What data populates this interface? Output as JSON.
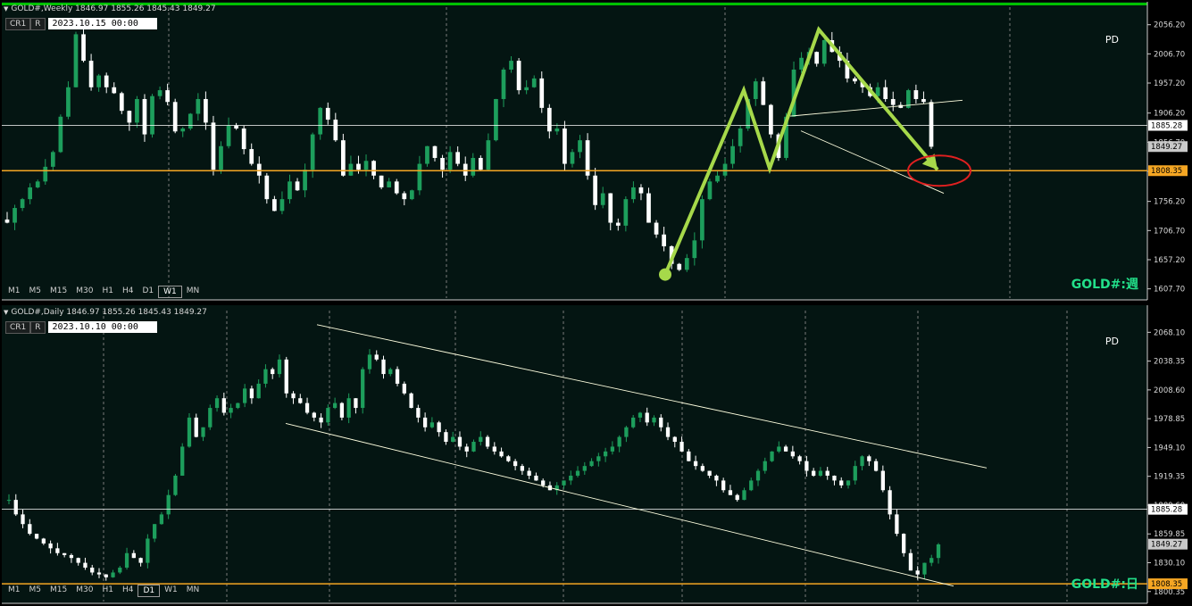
{
  "chart_data": [
    {
      "type": "candlestick",
      "symbol": "GOLD#",
      "timeframe": "Weekly",
      "header": "GOLD#,Weekly  1846.97 1855.26 1845.43 1849.27",
      "ohlc_header": {
        "open": 1846.97,
        "high": 1855.26,
        "low": 1845.43,
        "close": 1849.27
      },
      "date_cursor": "2023.10.15 00:00",
      "price_axis": {
        "min": 1592,
        "max": 2080,
        "ticks": [
          "2056.20",
          "2006.70",
          "1957.20",
          "1906.20",
          "1856.70",
          "1807.20",
          "1756.20",
          "1706.70",
          "1657.20",
          "1607.70"
        ],
        "tick_values": [
          2056.2,
          2006.7,
          1957.2,
          1906.2,
          1856.7,
          1807.2,
          1756.2,
          1706.7,
          1657.2,
          1607.7
        ]
      },
      "horizontal_lines": [
        {
          "price": 1885.28,
          "label": "1885.28",
          "color": "#ffffff"
        },
        {
          "price": 1808.35,
          "label": "1808.35",
          "color": "#f5a623"
        }
      ],
      "current_price": {
        "price": 1849.27,
        "label": "1849.27"
      },
      "overlay_text": "PD",
      "watermark": "GOLD#:週",
      "trendlines": [
        [
          [
            885,
            1901
          ],
          [
            1078,
            1928
          ]
        ],
        [
          [
            897,
            1876
          ],
          [
            1057,
            1770
          ]
        ]
      ],
      "annotation_zigzag": [
        [
          745,
          1632
        ],
        [
          833,
          1945
        ],
        [
          862,
          1812
        ],
        [
          917,
          2048
        ],
        [
          1050,
          1810
        ]
      ],
      "closes": [
        1720,
        1745,
        1760,
        1780,
        1790,
        1815,
        1840,
        1900,
        1950,
        2040,
        1995,
        1950,
        1970,
        1950,
        1940,
        1910,
        1890,
        1930,
        1870,
        1935,
        1945,
        1925,
        1875,
        1880,
        1905,
        1930,
        1890,
        1810,
        1850,
        1885,
        1880,
        1845,
        1820,
        1800,
        1760,
        1740,
        1760,
        1790,
        1775,
        1810,
        1870,
        1915,
        1895,
        1860,
        1800,
        1820,
        1810,
        1825,
        1800,
        1780,
        1790,
        1770,
        1760,
        1775,
        1820,
        1850,
        1830,
        1810,
        1840,
        1820,
        1800,
        1830,
        1810,
        1860,
        1930,
        1980,
        1995,
        1945,
        1950,
        1965,
        1915,
        1875,
        1880,
        1820,
        1840,
        1860,
        1800,
        1750,
        1770,
        1720,
        1715,
        1760,
        1780,
        1770,
        1720,
        1700,
        1680,
        1650,
        1640,
        1660,
        1690,
        1760,
        1790,
        1800,
        1820,
        1850,
        1880,
        1930,
        1960,
        1920,
        1870,
        1830,
        1900,
        1980,
        2000,
        2010,
        1990,
        2030,
        2010,
        1995,
        1965,
        1960,
        1950,
        1935,
        1950,
        1930,
        1920,
        1915,
        1945,
        1930,
        1925,
        1849
      ],
      "volatility": 14
    },
    {
      "type": "candlestick",
      "symbol": "GOLD#",
      "timeframe": "Daily",
      "header": "GOLD#,Daily  1846.97 1855.26 1845.43 1849.27",
      "ohlc_header": {
        "open": 1846.97,
        "high": 1855.26,
        "low": 1845.43,
        "close": 1849.27
      },
      "date_cursor": "2023.10.10 00:00",
      "price_axis": {
        "min": 1790,
        "max": 2085,
        "ticks": [
          "2068.10",
          "2038.35",
          "2008.60",
          "1978.85",
          "1949.10",
          "1919.35",
          "1889.60",
          "1859.85",
          "1830.10",
          "1800.35"
        ],
        "tick_values": [
          2068.1,
          2038.35,
          2008.6,
          1978.85,
          1949.1,
          1919.35,
          1889.6,
          1859.85,
          1830.1,
          1800.35
        ]
      },
      "horizontal_lines": [
        {
          "price": 1885.28,
          "label": "1885.28",
          "color": "#ffffff"
        },
        {
          "price": 1808.35,
          "label": "1808.35",
          "color": "#f5a623"
        }
      ],
      "current_price": {
        "price": 1849.27,
        "label": "1849.27"
      },
      "overlay_text": "PD",
      "watermark": "GOLD#:日",
      "trendlines": [
        [
          [
            355,
            2076
          ],
          [
            1105,
            1928
          ]
        ],
        [
          [
            320,
            1974
          ],
          [
            1068,
            1806
          ]
        ]
      ],
      "closes": [
        1895,
        1880,
        1870,
        1860,
        1855,
        1850,
        1845,
        1840,
        1838,
        1835,
        1830,
        1825,
        1820,
        1818,
        1815,
        1820,
        1825,
        1840,
        1835,
        1830,
        1855,
        1870,
        1880,
        1900,
        1920,
        1950,
        1980,
        1960,
        1970,
        1990,
        2000,
        1985,
        1990,
        1995,
        2010,
        2000,
        2015,
        2030,
        2025,
        2040,
        2005,
        2000,
        1995,
        1985,
        1980,
        1975,
        1990,
        1995,
        1980,
        2000,
        1990,
        2030,
        2045,
        2040,
        2025,
        2030,
        2015,
        2005,
        1990,
        1980,
        1970,
        1975,
        1965,
        1955,
        1960,
        1950,
        1945,
        1955,
        1960,
        1950,
        1945,
        1940,
        1935,
        1930,
        1925,
        1920,
        1915,
        1910,
        1905,
        1910,
        1915,
        1920,
        1925,
        1930,
        1935,
        1940,
        1945,
        1950,
        1960,
        1970,
        1980,
        1985,
        1975,
        1980,
        1970,
        1960,
        1955,
        1945,
        1935,
        1930,
        1925,
        1920,
        1915,
        1905,
        1900,
        1895,
        1905,
        1915,
        1925,
        1935,
        1945,
        1950,
        1945,
        1940,
        1935,
        1925,
        1920,
        1925,
        1920,
        1915,
        1910,
        1915,
        1930,
        1940,
        1935,
        1925,
        1905,
        1880,
        1860,
        1840,
        1822,
        1818,
        1830,
        1835,
        1849
      ],
      "volatility": 6
    }
  ],
  "ui": {
    "toolbar": {
      "cr1": "CR1",
      "r": "R"
    },
    "weekly_timeframes": [
      "M1",
      "M5",
      "M15",
      "M30",
      "H1",
      "H4",
      "D1",
      "W1",
      "MN"
    ],
    "weekly_active": "W1",
    "daily_timeframes": [
      "M1",
      "M5",
      "M15",
      "M30",
      "H1",
      "H4",
      "D1",
      "W1",
      "MN"
    ],
    "daily_active": "D1",
    "colors": {
      "bull": "#1d9e5c",
      "bear": "#ffffff",
      "grid": "#7a7a7a",
      "support": "#f5a623",
      "zigzag": "#a6d94a",
      "circle": "#e02020",
      "frame_top": "#00c000"
    }
  }
}
